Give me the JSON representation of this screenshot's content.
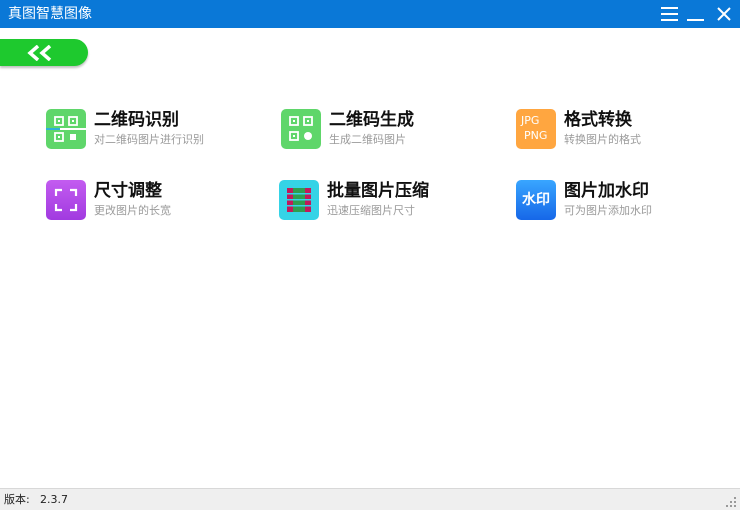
{
  "window": {
    "title": "真图智慧图像",
    "accent_color": "#0a78d7",
    "controls": [
      "menu-icon",
      "minimize-icon",
      "close-icon"
    ]
  },
  "back_button": {
    "icon": "double-chevron-left-icon",
    "color": "#1ec92e"
  },
  "tools": [
    {
      "name": "二维码识别",
      "desc": "对二维码图片进行识别",
      "icon": "qr-scan-icon",
      "color": "#5fd66a"
    },
    {
      "name": "二维码生成",
      "desc": "生成二维码图片",
      "icon": "qr-code-icon",
      "color": "#5fd66a"
    },
    {
      "name": "格式转换",
      "desc": "转换图片的格式",
      "icon": "format-convert-icon",
      "color": "#ffa640",
      "icon_text": [
        "JPG",
        "PNG"
      ]
    },
    {
      "name": "尺寸调整",
      "desc": "更改图片的长宽",
      "icon": "resize-frame-icon",
      "color": "#b446e8"
    },
    {
      "name": "批量图片压缩",
      "desc": "迅速压缩图片尺寸",
      "icon": "compress-icon",
      "color": "#35d3e6"
    },
    {
      "name": "图片加水印",
      "desc": "可为图片添加水印",
      "icon": "watermark-icon",
      "color": "#2a86f5",
      "icon_text": "水印"
    }
  ],
  "status": {
    "version_label": "版本:",
    "version": "2.3.7"
  }
}
